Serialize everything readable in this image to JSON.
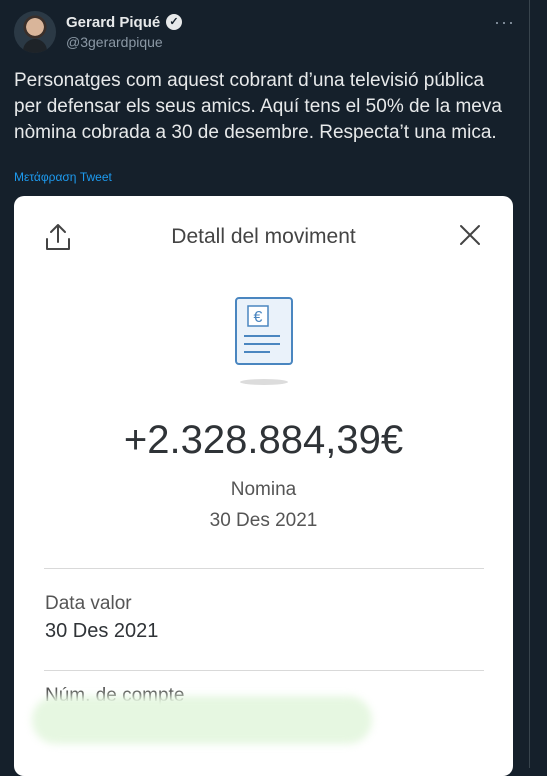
{
  "tweet": {
    "author_name": "Gerard Piqué",
    "verified_glyph": "✓",
    "handle": "@3gerardpique",
    "more_glyph": "···",
    "text": "Personatges com aquest cobrant d’una televisió pública per defensar els seus amics. Aquí tens el 50% de la meva nòmina cobrada a 30 de desembre. Respecta’t una mica.",
    "translate_link": "Μετάφραση Tweet"
  },
  "receipt_card": {
    "title": "Detall del moviment",
    "share_icon": "share-icon",
    "close_icon": "close-icon",
    "receipt_icon": "euro-receipt-icon",
    "receipt_symbol": "€",
    "amount": "+2.328.884,39€",
    "concept": "Nomina",
    "date": "30 Des 2021",
    "value_date_label": "Data valor",
    "value_date": "30 Des 2021",
    "account_label": "Núm. de compte"
  },
  "colors": {
    "background": "#15202b",
    "primary_text": "#e7e9ea",
    "secondary_text": "#8b98a5",
    "link": "#1d9bf0",
    "card_background": "#ffffff",
    "receipt_accent": "#4a86c0"
  }
}
